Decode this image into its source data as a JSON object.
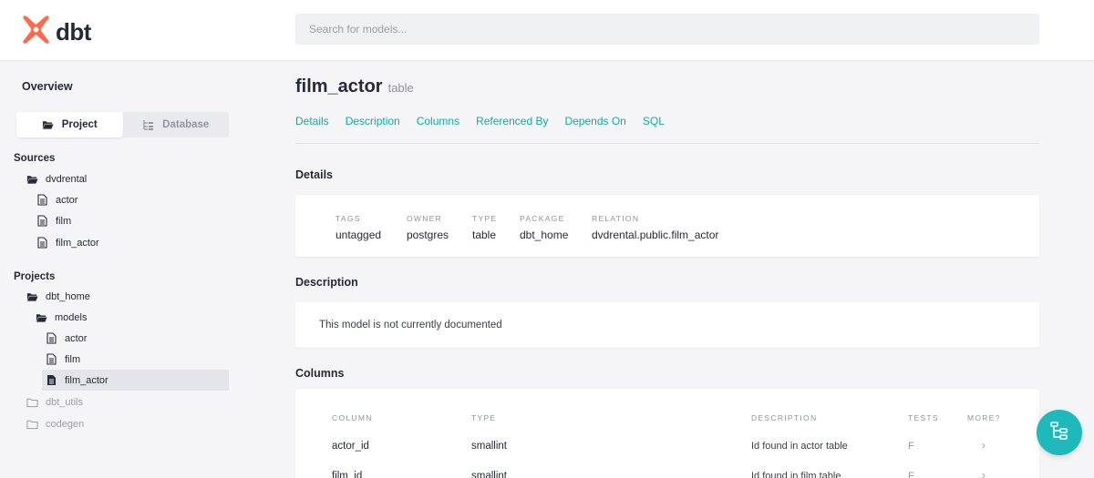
{
  "app": {
    "name": "dbt",
    "brand_color": "#ff694b",
    "accent_color": "#13a8a8"
  },
  "search": {
    "placeholder": "Search for models..."
  },
  "sidebar": {
    "overview_label": "Overview",
    "switch": {
      "project_label": "Project",
      "database_label": "Database",
      "active": "Project"
    },
    "sources_heading": "Sources",
    "sources": [
      {
        "label": "dvdrental",
        "icon": "folder-open-icon",
        "children": [
          "actor",
          "film",
          "film_actor"
        ]
      }
    ],
    "projects_heading": "Projects",
    "projects": {
      "dbt_home": "dbt_home",
      "models": "models",
      "model_files": [
        "actor",
        "film",
        "film_actor"
      ],
      "selected": "film_actor",
      "other": [
        "dbt_utils",
        "codegen"
      ]
    }
  },
  "main": {
    "title": "film_actor",
    "subtitle": "table",
    "tabs": [
      "Details",
      "Description",
      "Columns",
      "Referenced By",
      "Depends On",
      "SQL"
    ],
    "details": {
      "heading": "Details",
      "fields": [
        {
          "label": "TAGS",
          "value": "untagged"
        },
        {
          "label": "OWNER",
          "value": "postgres"
        },
        {
          "label": "TYPE",
          "value": "table"
        },
        {
          "label": "PACKAGE",
          "value": "dbt_home"
        },
        {
          "label": "RELATION",
          "value": "dvdrental.public.film_actor"
        }
      ]
    },
    "description": {
      "heading": "Description",
      "text": "This model is not currently documented"
    },
    "columns": {
      "heading": "Columns",
      "headers": [
        "COLUMN",
        "TYPE",
        "DESCRIPTION",
        "TESTS",
        "MORE?"
      ],
      "rows": [
        {
          "column": "actor_id",
          "type": "smallint",
          "description": "Id found in actor table",
          "tests": "F",
          "more": "›"
        },
        {
          "column": "film_id",
          "type": "smallint",
          "description": "Id found in film table",
          "tests": "F",
          "more": "›"
        }
      ]
    }
  },
  "fab": {
    "icon": "lineage-graph-icon"
  }
}
